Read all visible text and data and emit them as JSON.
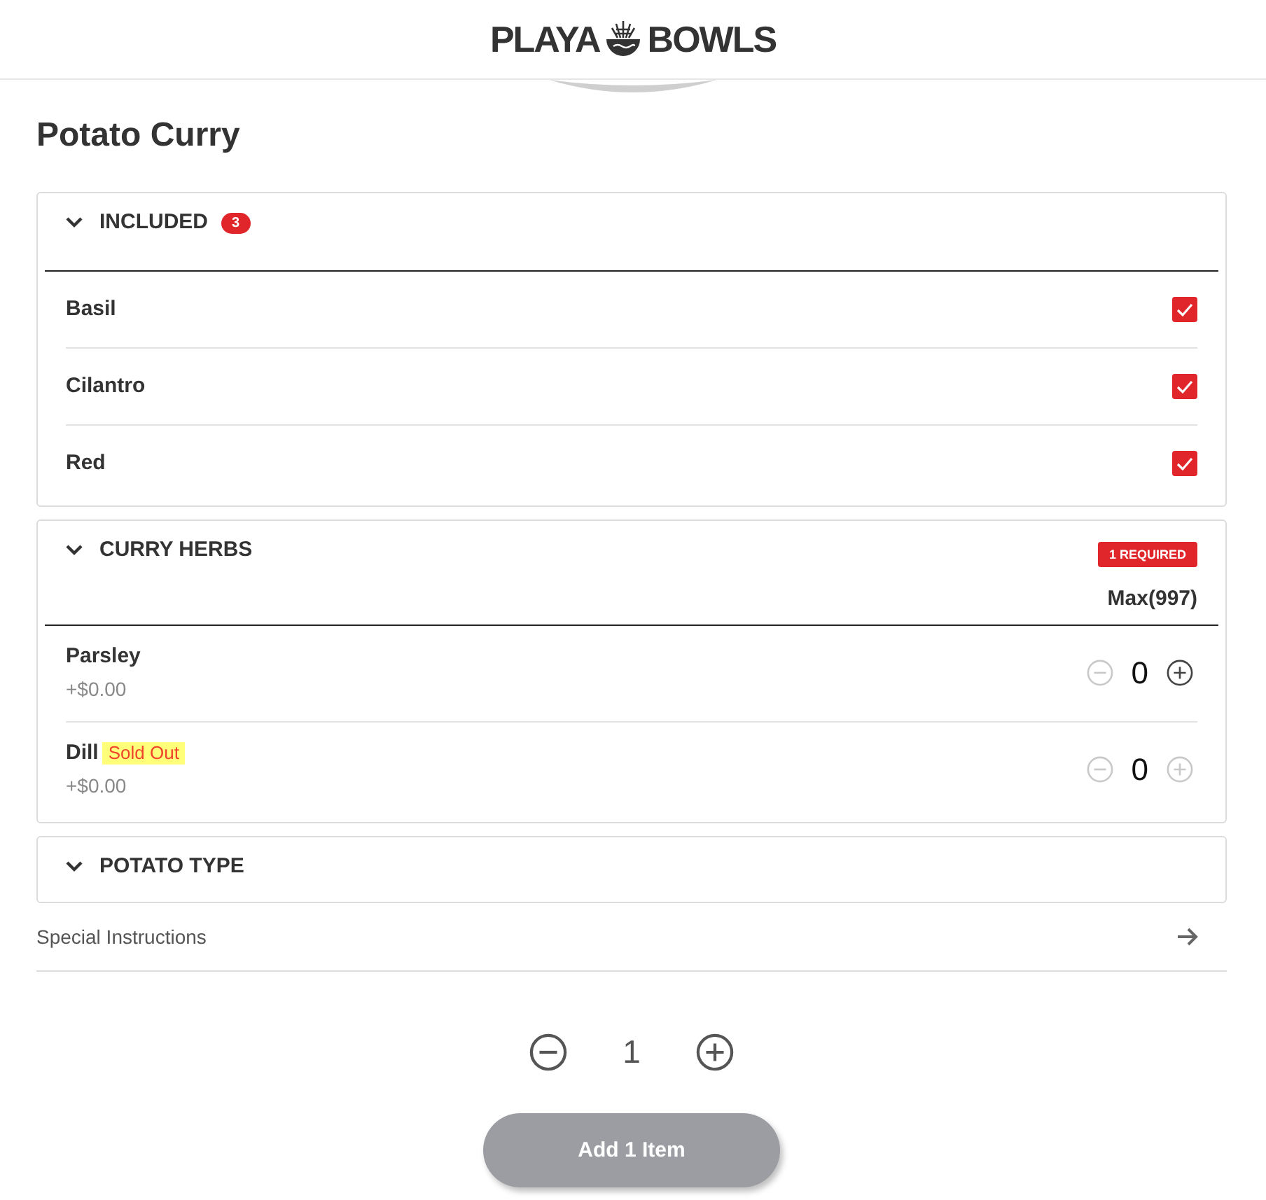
{
  "header": {
    "logo_words": [
      "PLAYA",
      "BOWLS"
    ]
  },
  "title": "Potato Curry",
  "groups": [
    {
      "kind": "checkbox",
      "name": "INCLUDED",
      "count": "3",
      "expanded": true,
      "items": [
        {
          "name": "Basil",
          "checked": true
        },
        {
          "name": "Cilantro",
          "checked": true
        },
        {
          "name": "Red",
          "checked": true
        }
      ]
    },
    {
      "kind": "quantity",
      "name": "CURRY HERBS",
      "requirement": "1 REQUIRED",
      "max": "Max(997)",
      "expanded": true,
      "items": [
        {
          "name": "Parsley",
          "price": "+$0.00",
          "quantity": "0",
          "decrease_disabled": true,
          "increase_disabled": false
        },
        {
          "name": "Dill",
          "tag": "Sold Out",
          "price": "+$0.00",
          "quantity": "0",
          "decrease_disabled": true,
          "increase_disabled": true
        }
      ]
    },
    {
      "name": "POTATO TYPE",
      "expanded": false
    }
  ],
  "special_instructions": {
    "label": "Special Instructions"
  },
  "quantity": {
    "value": "1",
    "decrease_disabled": false,
    "increase_disabled": false
  },
  "add_button": {
    "label": "Add 1 Item",
    "disabled": true
  }
}
